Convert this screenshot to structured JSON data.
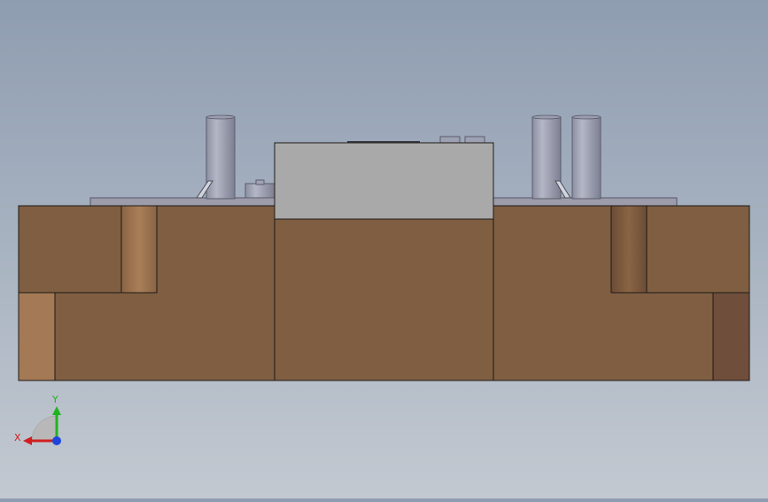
{
  "viewport": {
    "background_top": "#8f9db1",
    "background_bottom": "#c3c9d1",
    "part_colors": {
      "body": "#7f5e42",
      "body_light": "#a37a55",
      "body_dark": "#6f4e3c",
      "outline": "#1e1a16",
      "cover": "#a9a9a9",
      "plate": "#9c9caa",
      "pin": "#a7aab9"
    }
  },
  "triad": {
    "x_label": "X",
    "y_label": "Y",
    "x_color": "#d21e1e",
    "y_color": "#1eb41e",
    "z_color": "#1e46dc"
  }
}
